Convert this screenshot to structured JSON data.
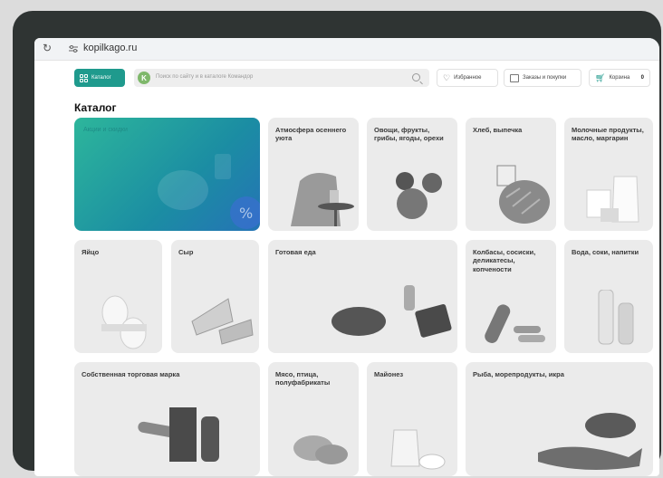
{
  "browser": {
    "url": "kopilkago.ru"
  },
  "header": {
    "catalog_label": "Каталог",
    "search_placeholder": "Поиск по сайту и в каталоге Командор",
    "favorites_label": "Избранное",
    "orders_label": "Заказы и покупки",
    "cart_label": "Корзина",
    "cart_count": "0"
  },
  "page": {
    "title": "Каталог"
  },
  "tiles": [
    {
      "label": "Акции и скидки"
    },
    {
      "label": "Атмосфера осеннего уюта"
    },
    {
      "label": "Овощи, фрукты, грибы, ягоды, орехи"
    },
    {
      "label": "Хлеб, выпечка"
    },
    {
      "label": "Молочные продукты, масло, маргарин"
    },
    {
      "label": "Яйцо"
    },
    {
      "label": "Сыр"
    },
    {
      "label": "Готовая еда"
    },
    {
      "label": "Колбасы, сосиски, деликатесы, копчености"
    },
    {
      "label": "Вода, соки, напитки"
    },
    {
      "label": "Собственная торговая марка"
    },
    {
      "label": "Мясо, птица, полуфабрикаты"
    },
    {
      "label": "Майонез"
    },
    {
      "label": "Рыба, морепродукты, икра"
    }
  ]
}
